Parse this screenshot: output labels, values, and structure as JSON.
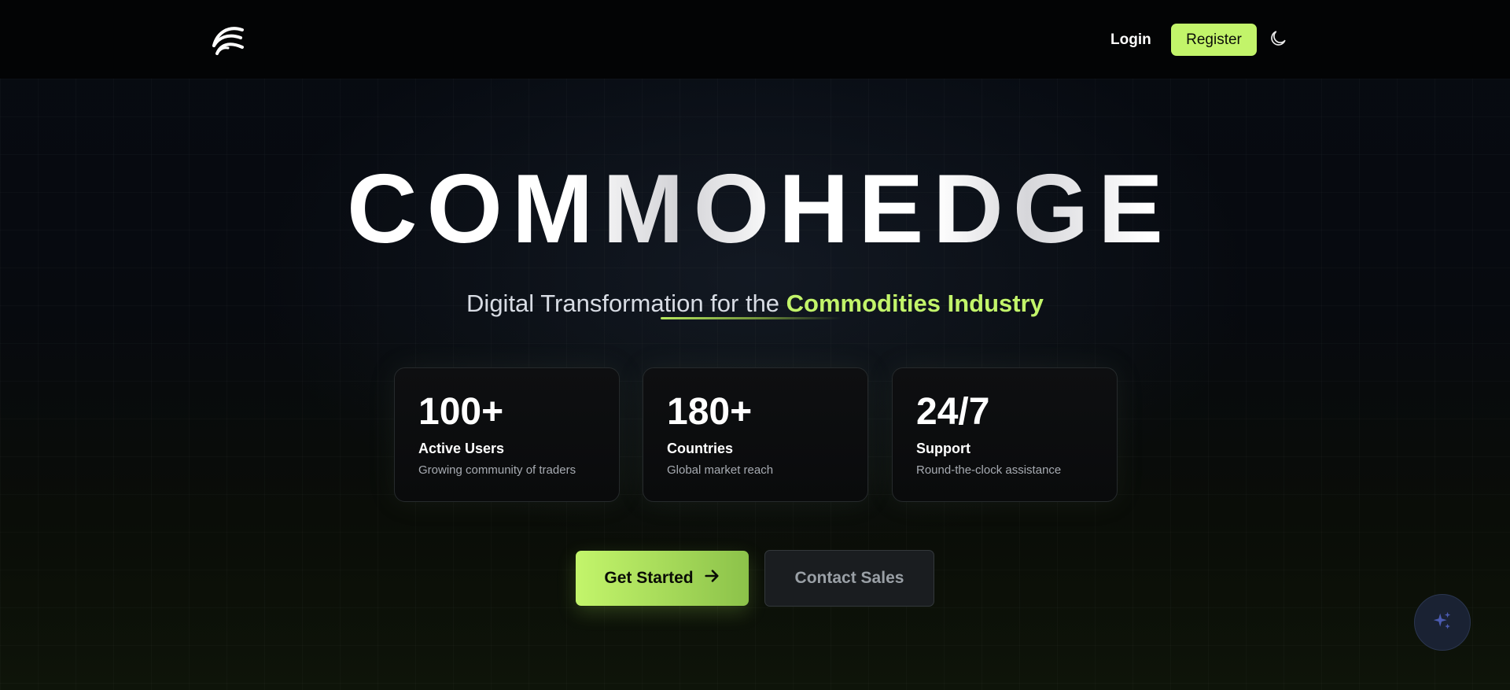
{
  "brand": {
    "logo_icon": "wing-arc-logo-icon",
    "accent_color": "#c2f46a"
  },
  "nav": {
    "login_label": "Login",
    "register_label": "Register",
    "theme_toggle_icon": "moon-icon"
  },
  "hero": {
    "title": "COMMOHEDGE",
    "subtitle_plain": "Digital Transformation for the ",
    "subtitle_accent": "Commodities Industry"
  },
  "stats": [
    {
      "value": "100+",
      "label": "Active Users",
      "description": "Growing community of traders"
    },
    {
      "value": "180+",
      "label": "Countries",
      "description": "Global market reach"
    },
    {
      "value": "24/7",
      "label": "Support",
      "description": "Round-the-clock assistance"
    }
  ],
  "cta": {
    "primary_label": "Get Started",
    "primary_icon": "arrow-right-icon",
    "secondary_label": "Contact Sales"
  },
  "assistant": {
    "icon": "sparkles-icon"
  }
}
